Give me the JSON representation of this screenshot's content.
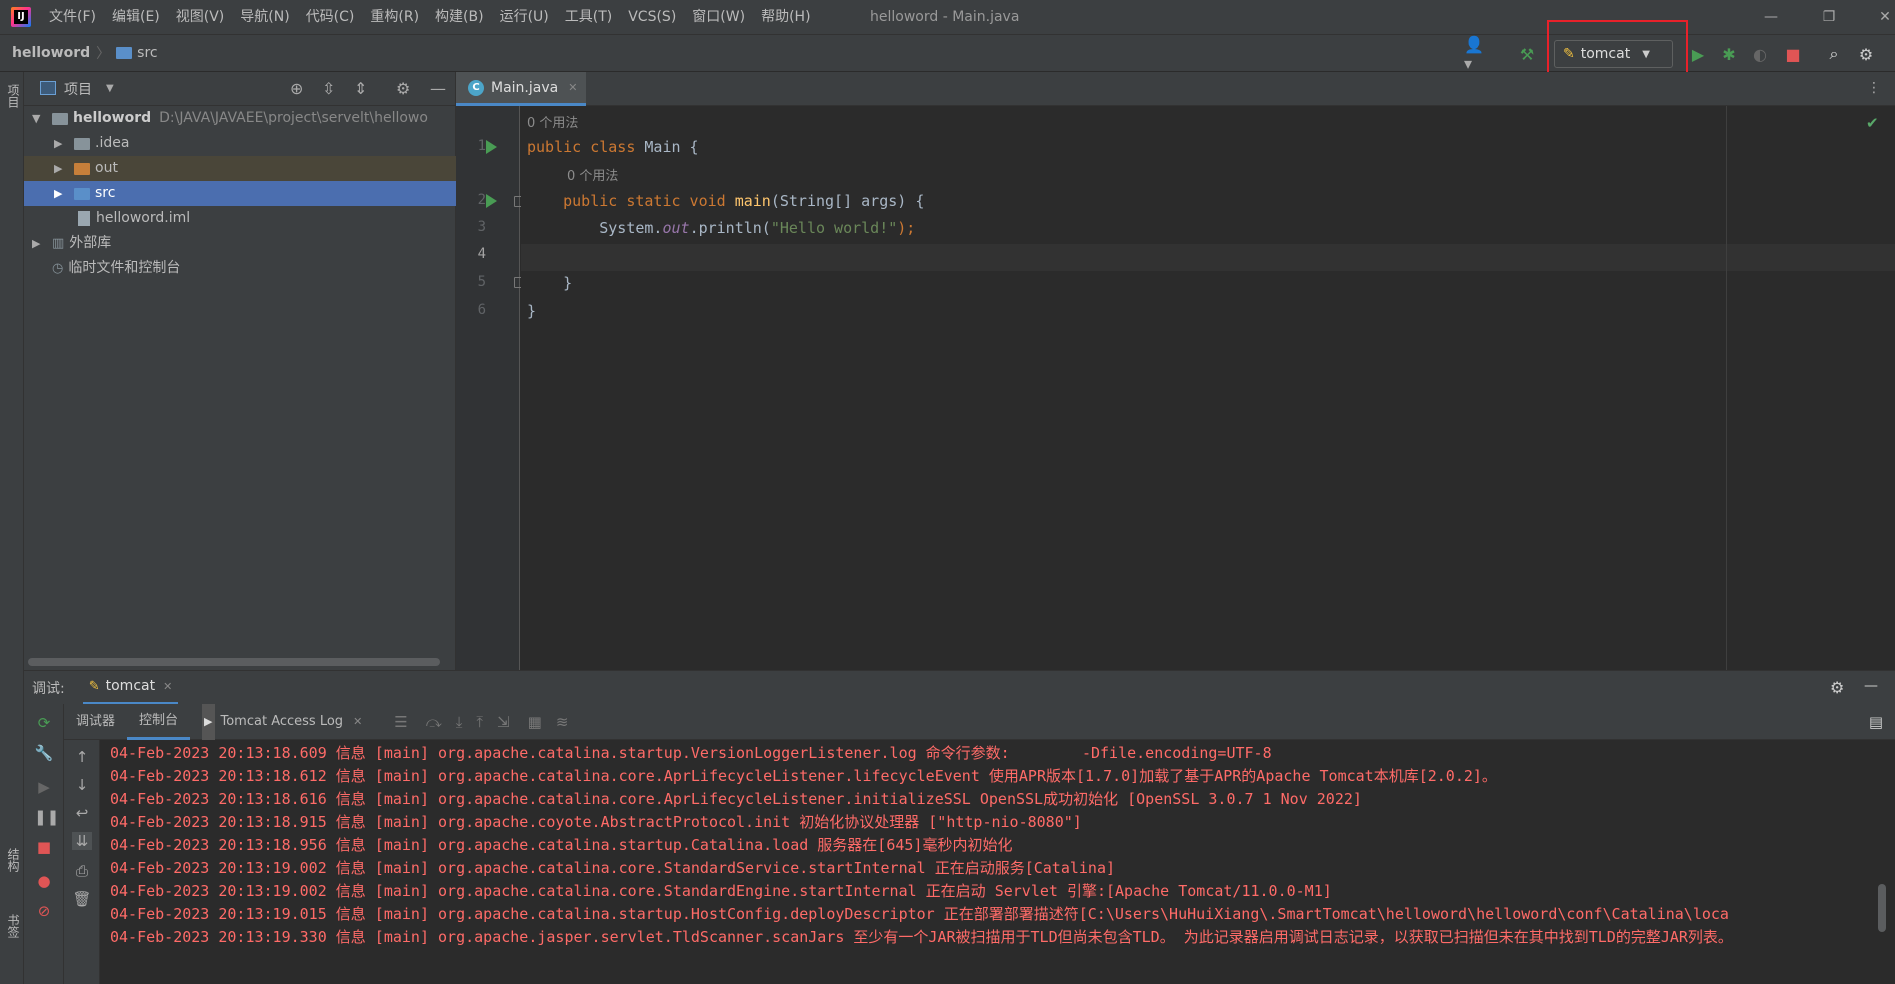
{
  "menubar": {
    "items": [
      "文件(F)",
      "编辑(E)",
      "视图(V)",
      "导航(N)",
      "代码(C)",
      "重构(R)",
      "构建(B)",
      "运行(U)",
      "工具(T)",
      "VCS(S)",
      "窗口(W)",
      "帮助(H)"
    ],
    "window_title": "helloword - Main.java"
  },
  "navbar": {
    "project": "helloword",
    "folder": "src"
  },
  "run_config": {
    "label": "tomcat"
  },
  "left_strip": {
    "project_tab": "项目",
    "structure_tab": "结构",
    "bookmarks_tab": "书签"
  },
  "project_panel": {
    "title": "项目",
    "tree": [
      {
        "label": "helloword",
        "path": "D:\\JAVA\\JAVAEE\\project\\servelt\\hellowo",
        "level": 0,
        "expanded": true,
        "bold": true
      },
      {
        "label": ".idea",
        "level": 1,
        "expanded": false
      },
      {
        "label": "out",
        "level": 1,
        "expanded": false
      },
      {
        "label": "src",
        "level": 1,
        "expanded": false,
        "selected": true
      },
      {
        "label": "helloword.iml",
        "level": 1
      },
      {
        "label": "外部库",
        "level": 0,
        "expanded": false
      },
      {
        "label": "临时文件和控制台",
        "level": 0
      }
    ]
  },
  "editor": {
    "tab_label": "Main.java",
    "usage_hint_1": "0 个用法",
    "usage_hint_2": "0 个用法",
    "line_numbers": [
      "1",
      "2",
      "3",
      "4",
      "5",
      "6"
    ],
    "code": {
      "l1_kw": "public class ",
      "l1_rest": "Main {",
      "l2_indent": "    ",
      "l2_kw": "public static void ",
      "l2_fn": "main",
      "l2_rest": "(String[] args) {",
      "l3_a": "        System.",
      "l3_fld": "out",
      "l3_b": ".println(",
      "l3_str": "\"Hello world!\"",
      "l3_c": ");",
      "l5": "    }",
      "l6": "}"
    }
  },
  "debug": {
    "header_label": "调试:",
    "session_tab": "tomcat",
    "subtabs": [
      "调试器",
      "控制台",
      "Tomcat Access Log"
    ],
    "console_lines": [
      "04-Feb-2023 20:13:18.609 信息 [main] org.apache.catalina.startup.VersionLoggerListener.log 命令行参数:        -Dfile.encoding=UTF-8",
      "04-Feb-2023 20:13:18.612 信息 [main] org.apache.catalina.core.AprLifecycleListener.lifecycleEvent 使用APR版本[1.7.0]加载了基于APR的Apache Tomcat本机库[2.0.2]。",
      "04-Feb-2023 20:13:18.616 信息 [main] org.apache.catalina.core.AprLifecycleListener.initializeSSL OpenSSL成功初始化 [OpenSSL 3.0.7 1 Nov 2022]",
      "04-Feb-2023 20:13:18.915 信息 [main] org.apache.coyote.AbstractProtocol.init 初始化协议处理器 [\"http-nio-8080\"]",
      "04-Feb-2023 20:13:18.956 信息 [main] org.apache.catalina.startup.Catalina.load 服务器在[645]毫秒内初始化",
      "04-Feb-2023 20:13:19.002 信息 [main] org.apache.catalina.core.StandardService.startInternal 正在启动服务[Catalina]",
      "04-Feb-2023 20:13:19.002 信息 [main] org.apache.catalina.core.StandardEngine.startInternal 正在启动 Servlet 引擎:[Apache Tomcat/11.0.0-M1]",
      "04-Feb-2023 20:13:19.015 信息 [main] org.apache.catalina.startup.HostConfig.deployDescriptor 正在部署部署描述符[C:\\Users\\HuHuiXiang\\.SmartTomcat\\helloword\\helloword\\conf\\Catalina\\loca",
      "04-Feb-2023 20:13:19.330 信息 [main] org.apache.jasper.servlet.TldScanner.scanJars 至少有一个JAR被扫描用于TLD但尚未包含TLD。 为此记录器启用调试日志记录，以获取已扫描但未在其中找到TLD的完整JAR列表。"
    ]
  },
  "colors": {
    "accent_blue": "#4a88c7",
    "selection": "#4b6eaf",
    "run_green": "#499c54",
    "error_red": "#ff6b68",
    "highlight_box": "#e8212a"
  }
}
